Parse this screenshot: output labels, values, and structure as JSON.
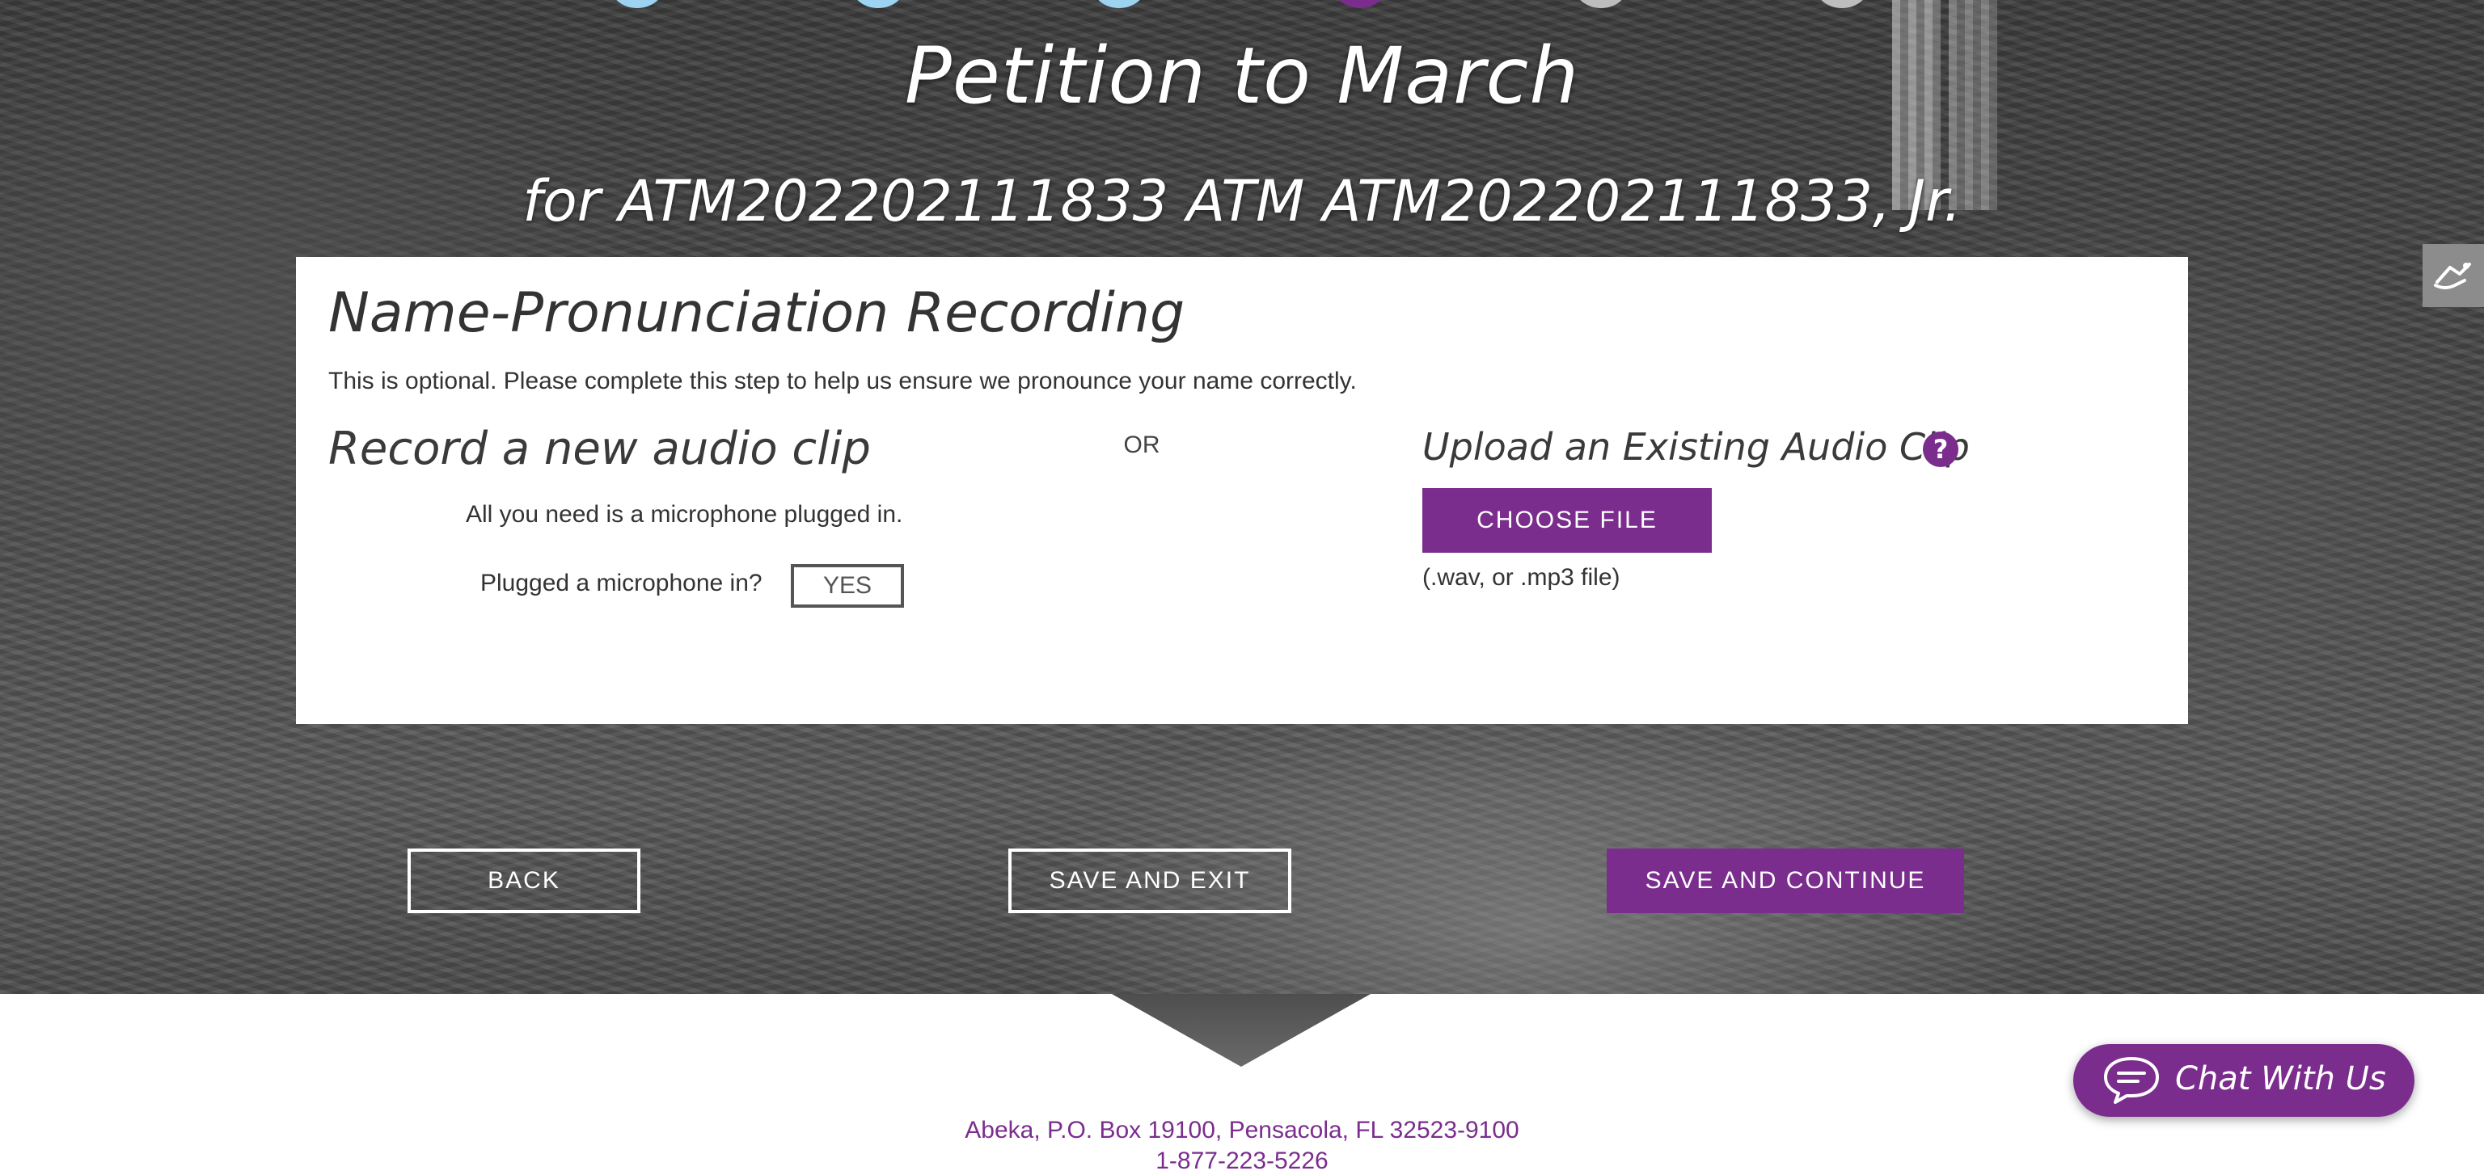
{
  "header": {
    "title": "Petition to March",
    "subtitle": "for ATM202202111833 ATM ATM202202111833, Jr."
  },
  "progress_steps": [
    {
      "color": "#9bd3f0"
    },
    {
      "color": "#9bd3f0"
    },
    {
      "color": "#9bd3f0"
    },
    {
      "color": "#7b2d8e"
    },
    {
      "color": "#bdbdbd"
    },
    {
      "color": "#bdbdbd"
    }
  ],
  "card": {
    "heading": "Name-Pronunciation Recording",
    "intro": "This is optional. Please complete this step to help us ensure we pronounce your name correctly.",
    "record": {
      "heading": "Record a new audio clip",
      "hint": "All you need is a microphone plugged in.",
      "question": "Plugged a microphone in?",
      "yes_label": "YES"
    },
    "or_label": "OR",
    "upload": {
      "heading": "Upload an Existing Audio Clip",
      "help_icon": "question-circle-icon",
      "choose_label": "CHOOSE FILE",
      "file_note": "(.wav, or .mp3 file)"
    }
  },
  "nav": {
    "back_label": "BACK",
    "save_exit_label": "SAVE AND EXIT",
    "save_continue_label": "SAVE AND CONTINUE"
  },
  "side_tab": {
    "icon": "accessibility-icon"
  },
  "footer": {
    "address": "Abeka, P.O. Box 19100, Pensacola, FL  32523-9100",
    "phone": "1-877-223-5226"
  },
  "chat": {
    "label": "Chat With Us",
    "icon": "chat-bubble-icon"
  },
  "colors": {
    "accent": "#7b2d8e",
    "step_done": "#9bd3f0",
    "step_pending": "#bdbdbd"
  }
}
